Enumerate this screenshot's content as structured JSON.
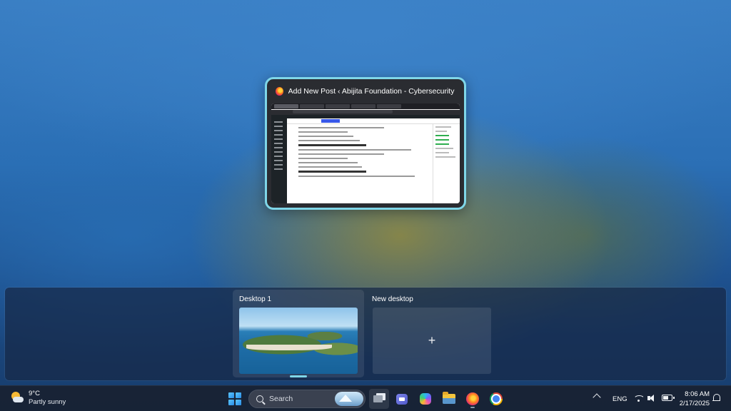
{
  "window_thumbnail": {
    "title": "Add New Post ‹ Abijita Foundation - Cybersecurity New..."
  },
  "desktops": [
    {
      "label": "Desktop 1",
      "selected": true
    },
    {
      "label": "New desktop",
      "plus": "+"
    }
  ],
  "taskbar": {
    "weather": {
      "temp": "9°C",
      "desc": "Partly sunny",
      "icon": "partly-sunny-icon"
    },
    "search": {
      "label": "Search"
    },
    "apps": [
      "task-view",
      "teams",
      "copilot",
      "file-explorer",
      "firefox",
      "chrome"
    ],
    "tray": {
      "language": "ENG",
      "time": "8:06 AM",
      "date": "2/17/2025",
      "battery_level": 0.6
    }
  },
  "colors": {
    "accent": "#7fd6e8",
    "taskbar": "#182234"
  }
}
